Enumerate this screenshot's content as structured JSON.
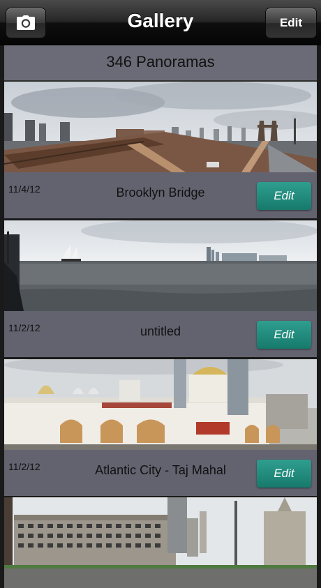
{
  "navbar": {
    "title": "Gallery",
    "edit_label": "Edit",
    "camera_icon": "camera-icon"
  },
  "gallery": {
    "count_label": "346 Panoramas",
    "items": [
      {
        "date": "11/4/12",
        "title": "Brooklyn Bridge",
        "edit_label": "Edit"
      },
      {
        "date": "11/2/12",
        "title": "untitled",
        "edit_label": "Edit"
      },
      {
        "date": "11/2/12",
        "title": "Atlantic City - Taj Mahal",
        "edit_label": "Edit"
      },
      {
        "date": "",
        "title": "",
        "edit_label": ""
      }
    ]
  },
  "colors": {
    "edit_button": "#1f8a7b",
    "info_bar": "#636370",
    "header_bar": "#6b6b77"
  }
}
